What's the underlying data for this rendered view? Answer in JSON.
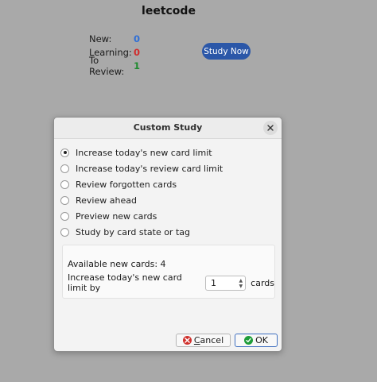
{
  "deck": {
    "title": "leetcode",
    "counts": [
      {
        "label": "New:",
        "value": "0",
        "color": "#2f6fd6"
      },
      {
        "label": "Learning:",
        "value": "0",
        "color": "#d02c2c"
      },
      {
        "label": "To Review:",
        "value": "1",
        "color": "#1e8a2e"
      }
    ],
    "study_now_label": "Study Now",
    "study_now_color": "#2b57a8"
  },
  "dialog": {
    "title": "Custom Study",
    "close_icon": "close-icon",
    "options": [
      {
        "label": "Increase today's new card limit",
        "checked": true
      },
      {
        "label": "Increase today's review card limit",
        "checked": false
      },
      {
        "label": "Review forgotten cards",
        "checked": false
      },
      {
        "label": "Review ahead",
        "checked": false
      },
      {
        "label": "Preview new cards",
        "checked": false
      },
      {
        "label": "Study by card state or tag",
        "checked": false
      }
    ],
    "available_text": "Available new cards: 4",
    "limit_label": "Increase today's new card limit by",
    "limit_value": "1",
    "limit_suffix": "cards",
    "buttons": {
      "cancel_prefix": "",
      "cancel_mnemonic": "C",
      "cancel_rest": "ancel",
      "ok_label": "OK"
    },
    "icons": {
      "cancel": "cancel-icon",
      "ok": "check-icon"
    }
  }
}
